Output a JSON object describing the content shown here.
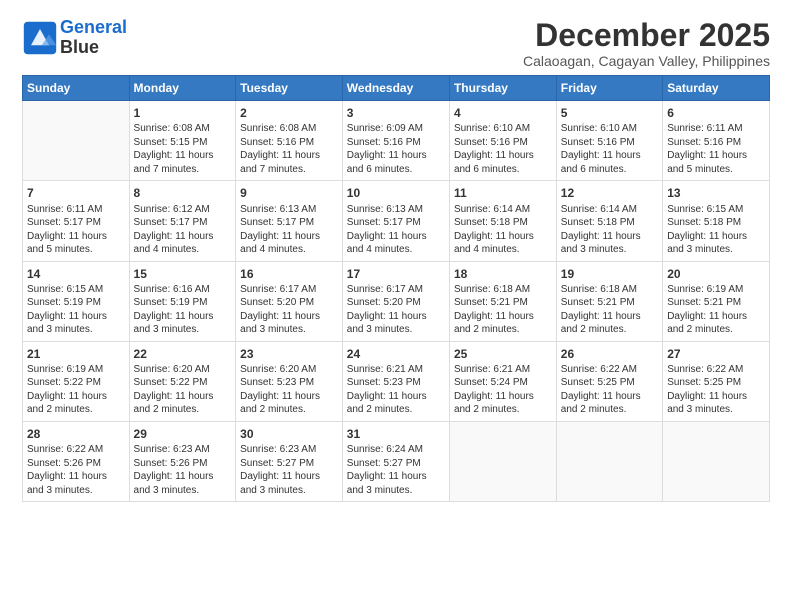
{
  "header": {
    "logo_line1": "General",
    "logo_line2": "Blue",
    "month": "December 2025",
    "location": "Calaoagan, Cagayan Valley, Philippines"
  },
  "weekdays": [
    "Sunday",
    "Monday",
    "Tuesday",
    "Wednesday",
    "Thursday",
    "Friday",
    "Saturday"
  ],
  "weeks": [
    [
      {
        "day": "",
        "info": ""
      },
      {
        "day": "1",
        "info": "Sunrise: 6:08 AM\nSunset: 5:15 PM\nDaylight: 11 hours\nand 7 minutes."
      },
      {
        "day": "2",
        "info": "Sunrise: 6:08 AM\nSunset: 5:16 PM\nDaylight: 11 hours\nand 7 minutes."
      },
      {
        "day": "3",
        "info": "Sunrise: 6:09 AM\nSunset: 5:16 PM\nDaylight: 11 hours\nand 6 minutes."
      },
      {
        "day": "4",
        "info": "Sunrise: 6:10 AM\nSunset: 5:16 PM\nDaylight: 11 hours\nand 6 minutes."
      },
      {
        "day": "5",
        "info": "Sunrise: 6:10 AM\nSunset: 5:16 PM\nDaylight: 11 hours\nand 6 minutes."
      },
      {
        "day": "6",
        "info": "Sunrise: 6:11 AM\nSunset: 5:16 PM\nDaylight: 11 hours\nand 5 minutes."
      }
    ],
    [
      {
        "day": "7",
        "info": "Sunrise: 6:11 AM\nSunset: 5:17 PM\nDaylight: 11 hours\nand 5 minutes."
      },
      {
        "day": "8",
        "info": "Sunrise: 6:12 AM\nSunset: 5:17 PM\nDaylight: 11 hours\nand 4 minutes."
      },
      {
        "day": "9",
        "info": "Sunrise: 6:13 AM\nSunset: 5:17 PM\nDaylight: 11 hours\nand 4 minutes."
      },
      {
        "day": "10",
        "info": "Sunrise: 6:13 AM\nSunset: 5:17 PM\nDaylight: 11 hours\nand 4 minutes."
      },
      {
        "day": "11",
        "info": "Sunrise: 6:14 AM\nSunset: 5:18 PM\nDaylight: 11 hours\nand 4 minutes."
      },
      {
        "day": "12",
        "info": "Sunrise: 6:14 AM\nSunset: 5:18 PM\nDaylight: 11 hours\nand 3 minutes."
      },
      {
        "day": "13",
        "info": "Sunrise: 6:15 AM\nSunset: 5:18 PM\nDaylight: 11 hours\nand 3 minutes."
      }
    ],
    [
      {
        "day": "14",
        "info": "Sunrise: 6:15 AM\nSunset: 5:19 PM\nDaylight: 11 hours\nand 3 minutes."
      },
      {
        "day": "15",
        "info": "Sunrise: 6:16 AM\nSunset: 5:19 PM\nDaylight: 11 hours\nand 3 minutes."
      },
      {
        "day": "16",
        "info": "Sunrise: 6:17 AM\nSunset: 5:20 PM\nDaylight: 11 hours\nand 3 minutes."
      },
      {
        "day": "17",
        "info": "Sunrise: 6:17 AM\nSunset: 5:20 PM\nDaylight: 11 hours\nand 3 minutes."
      },
      {
        "day": "18",
        "info": "Sunrise: 6:18 AM\nSunset: 5:21 PM\nDaylight: 11 hours\nand 2 minutes."
      },
      {
        "day": "19",
        "info": "Sunrise: 6:18 AM\nSunset: 5:21 PM\nDaylight: 11 hours\nand 2 minutes."
      },
      {
        "day": "20",
        "info": "Sunrise: 6:19 AM\nSunset: 5:21 PM\nDaylight: 11 hours\nand 2 minutes."
      }
    ],
    [
      {
        "day": "21",
        "info": "Sunrise: 6:19 AM\nSunset: 5:22 PM\nDaylight: 11 hours\nand 2 minutes."
      },
      {
        "day": "22",
        "info": "Sunrise: 6:20 AM\nSunset: 5:22 PM\nDaylight: 11 hours\nand 2 minutes."
      },
      {
        "day": "23",
        "info": "Sunrise: 6:20 AM\nSunset: 5:23 PM\nDaylight: 11 hours\nand 2 minutes."
      },
      {
        "day": "24",
        "info": "Sunrise: 6:21 AM\nSunset: 5:23 PM\nDaylight: 11 hours\nand 2 minutes."
      },
      {
        "day": "25",
        "info": "Sunrise: 6:21 AM\nSunset: 5:24 PM\nDaylight: 11 hours\nand 2 minutes."
      },
      {
        "day": "26",
        "info": "Sunrise: 6:22 AM\nSunset: 5:25 PM\nDaylight: 11 hours\nand 2 minutes."
      },
      {
        "day": "27",
        "info": "Sunrise: 6:22 AM\nSunset: 5:25 PM\nDaylight: 11 hours\nand 3 minutes."
      }
    ],
    [
      {
        "day": "28",
        "info": "Sunrise: 6:22 AM\nSunset: 5:26 PM\nDaylight: 11 hours\nand 3 minutes."
      },
      {
        "day": "29",
        "info": "Sunrise: 6:23 AM\nSunset: 5:26 PM\nDaylight: 11 hours\nand 3 minutes."
      },
      {
        "day": "30",
        "info": "Sunrise: 6:23 AM\nSunset: 5:27 PM\nDaylight: 11 hours\nand 3 minutes."
      },
      {
        "day": "31",
        "info": "Sunrise: 6:24 AM\nSunset: 5:27 PM\nDaylight: 11 hours\nand 3 minutes."
      },
      {
        "day": "",
        "info": ""
      },
      {
        "day": "",
        "info": ""
      },
      {
        "day": "",
        "info": ""
      }
    ]
  ]
}
